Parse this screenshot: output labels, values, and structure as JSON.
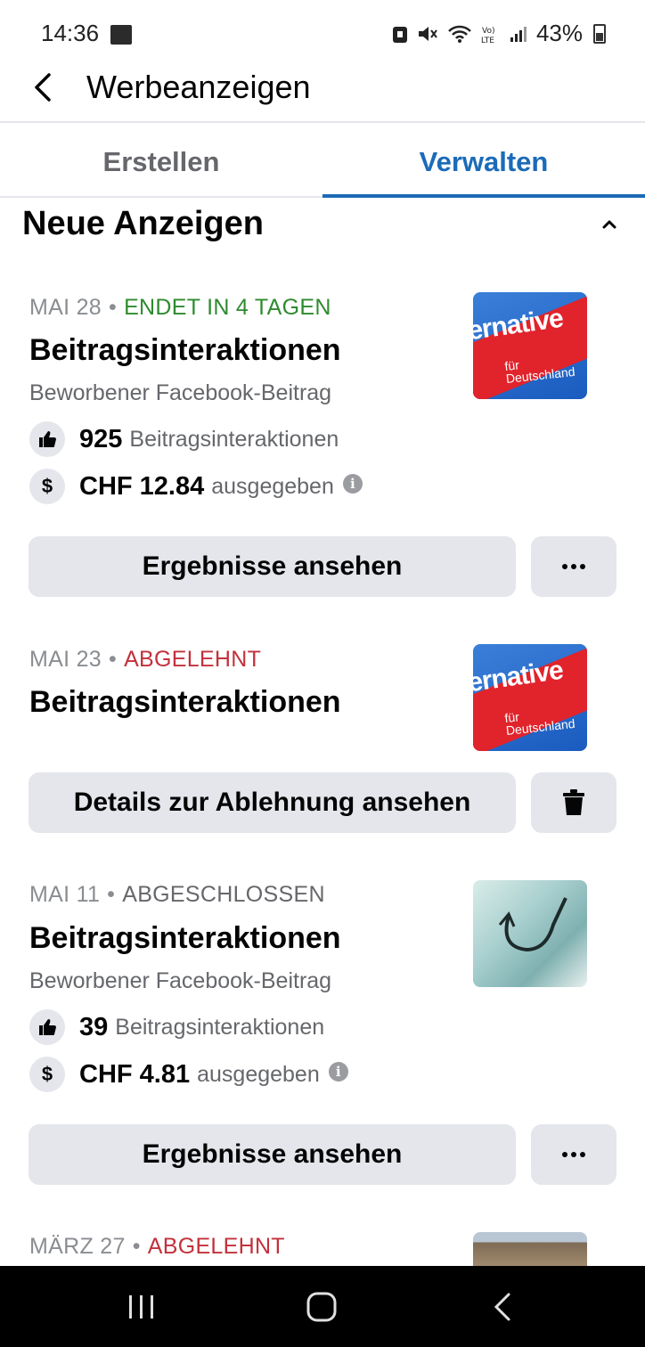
{
  "status_bar": {
    "time": "14:36",
    "battery": "43%"
  },
  "app_bar": {
    "title": "Werbeanzeigen",
    "back_icon": "chevron-left-icon"
  },
  "tabs": [
    {
      "label": "Erstellen",
      "active": false
    },
    {
      "label": "Verwalten",
      "active": true
    }
  ],
  "section": {
    "title": "Neue Anzeigen",
    "collapse_icon": "chevron-up-icon"
  },
  "ads": [
    {
      "date": "MAI 28",
      "status": "ENDET IN 4 TAGEN",
      "title": "Beitragsinteraktionen",
      "subtitle": "Beworbener Facebook-Beitrag",
      "interactions_value": "925",
      "interactions_label": "Beitragsinteraktionen",
      "spent_value": "CHF 12.84",
      "spent_label": "ausgegeben",
      "primary_button": "Ergebnisse ansehen",
      "secondary_icon": "more-icon",
      "thumb_word": "ernative",
      "thumb_sub1": "für",
      "thumb_sub2": "Deutschland"
    },
    {
      "date": "MAI 23",
      "status": "ABGELEHNT",
      "title": "Beitragsinteraktionen",
      "primary_button": "Details zur Ablehnung ansehen",
      "secondary_icon": "trash-icon",
      "thumb_word": "ernative",
      "thumb_sub1": "für",
      "thumb_sub2": "Deutschland"
    },
    {
      "date": "MAI 11",
      "status": "ABGESCHLOSSEN",
      "title": "Beitragsinteraktionen",
      "subtitle": "Beworbener Facebook-Beitrag",
      "interactions_value": "39",
      "interactions_label": "Beitragsinteraktionen",
      "spent_value": "CHF 4.81",
      "spent_label": "ausgegeben",
      "primary_button": "Ergebnisse ansehen",
      "secondary_icon": "more-icon"
    },
    {
      "date": "MÄRZ 27",
      "status": "ABGELEHNT"
    }
  ],
  "colors": {
    "accent": "#1b6bb8",
    "status_active": "#2e8b2e",
    "status_rejected": "#c2313c",
    "button_bg": "#e4e6eb"
  }
}
